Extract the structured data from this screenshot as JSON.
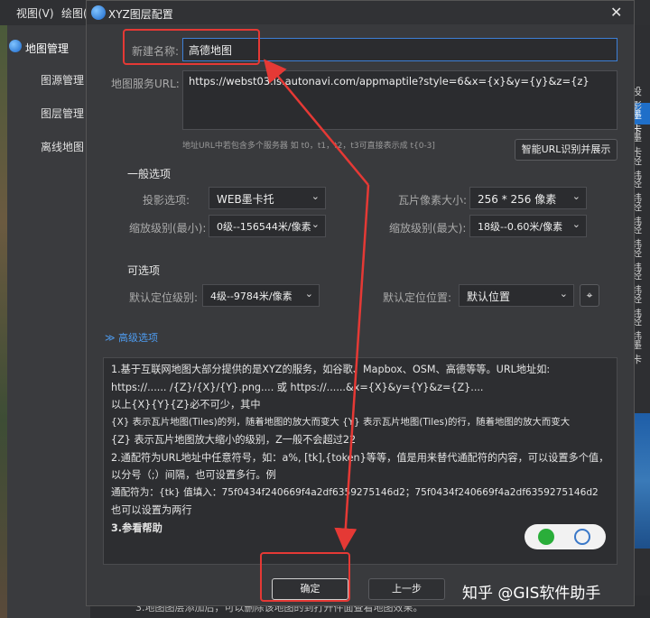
{
  "background": {
    "menu": [
      "视图(V)",
      "绘图("
    ],
    "panel_title": "地图管理",
    "panel_items": [
      "图源管理",
      "图层管理",
      "离线地图"
    ],
    "right_items": [
      "投影",
      "墨卡",
      "墨卡",
      "经纬",
      "经纬",
      "经纬",
      "经纬",
      "经纬",
      "经纬",
      "经纬",
      "经纬",
      "墨卡"
    ],
    "bottom_text": "3.地图图层添加后，可以删除该地图的到打开件面查看地图效果。"
  },
  "dialog": {
    "title": "XYZ图层配置",
    "name_label": "新建名称:",
    "name_value": "高德地图",
    "url_label": "地图服务URL:",
    "url_value": "https://webst03.is.autonavi.com/appmaptile?style=6&x={x}&y={y}&z={z}",
    "url_hint": "地址URL中若包含多个服务器 如 t0，t1，t2，t3可直接表示成 t{0-3]",
    "smart_btn": "智能URL识别并展示",
    "general_title": "一般选项",
    "projection_label": "投影选项:",
    "projection_value": "WEB墨卡托",
    "tile_size_label": "瓦片像素大小:",
    "tile_size_value": "256 * 256 像素",
    "zoom_min_label": "缩放级别(最小):",
    "zoom_min_value": "0级--156544米/像素",
    "zoom_max_label": "缩放级别(最大):",
    "zoom_max_value": "18级--0.60米/像素",
    "optional_title": "可选项",
    "default_level_label": "默认定位级别:",
    "default_level_value": "4级--9784米/像素",
    "default_pos_label": "默认定位位置:",
    "default_pos_value": "默认位置",
    "advanced": "≫ 高级选项",
    "notes": [
      "1.基于互联网地图大部分提供的是XYZ的服务，如谷歌、Mapbox、OSM、高德等等。URL地址如:",
      "https://...... /{Z}/{X}/{Y}.png....     或      https://......&x={X}&y={Y}&z={Z}....",
      "以上{X}{Y}{Z}必不可少，其中",
      "{X}    表示瓦片地图(Tiles)的列，随着地图的放大而变大           {Y}    表示瓦片地图(Tiles)的行，随着地图的放大而变大",
      "{Z}    表示瓦片地图放大缩小的级别，Z一般不会超过22",
      "2.通配符为URL地址中任意符号，如：a%, [tk],{token}等等，值是用来替代通配符的内容，可以设置多个值，",
      "以分号（;）间隔，也可设置多行。例",
      "通配符为：{tk} 值填入：75f0434f240669f4a2df6359275146d2；75f0434f240669f4a2df6359275146d2",
      "也可以设置为两行",
      "3.参看帮助"
    ],
    "ok": "确定",
    "prev": "上一步"
  },
  "watermark": "知乎 @GIS软件助手",
  "colors": {
    "accent": "#1f6fc9",
    "highlight": "#e53935"
  }
}
